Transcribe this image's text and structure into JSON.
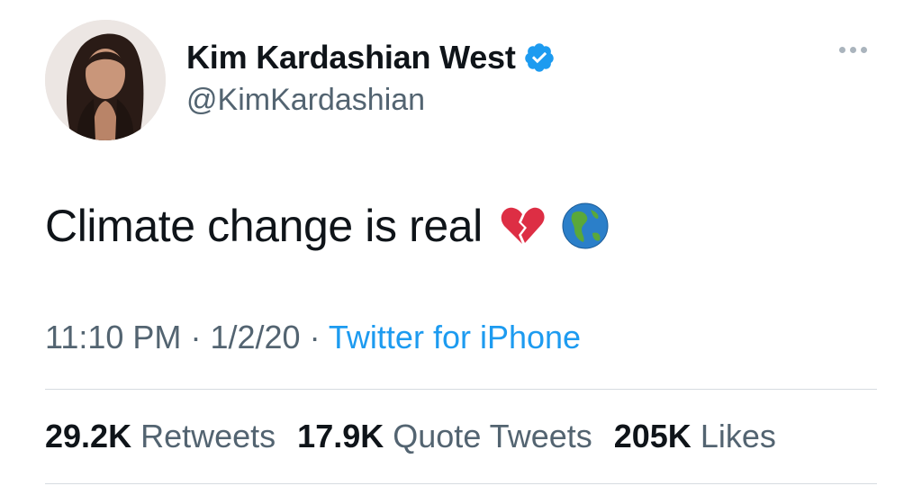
{
  "user": {
    "name": "Kim Kardashian West",
    "handle": "@KimKardashian",
    "verified": true
  },
  "tweet": {
    "text": "Climate change is real",
    "emojis": [
      "broken-heart",
      "globe-americas"
    ]
  },
  "meta": {
    "time": "11:10 PM",
    "separator": "·",
    "date": "1/2/20",
    "source": "Twitter for iPhone"
  },
  "stats": [
    {
      "value": "29.2K",
      "label": "Retweets"
    },
    {
      "value": "17.9K",
      "label": "Quote Tweets"
    },
    {
      "value": "205K",
      "label": "Likes"
    }
  ],
  "colors": {
    "link": "#1d9bf0",
    "secondary_text": "#536471",
    "primary_text": "#0f1419",
    "divider": "#d6dbe0"
  }
}
